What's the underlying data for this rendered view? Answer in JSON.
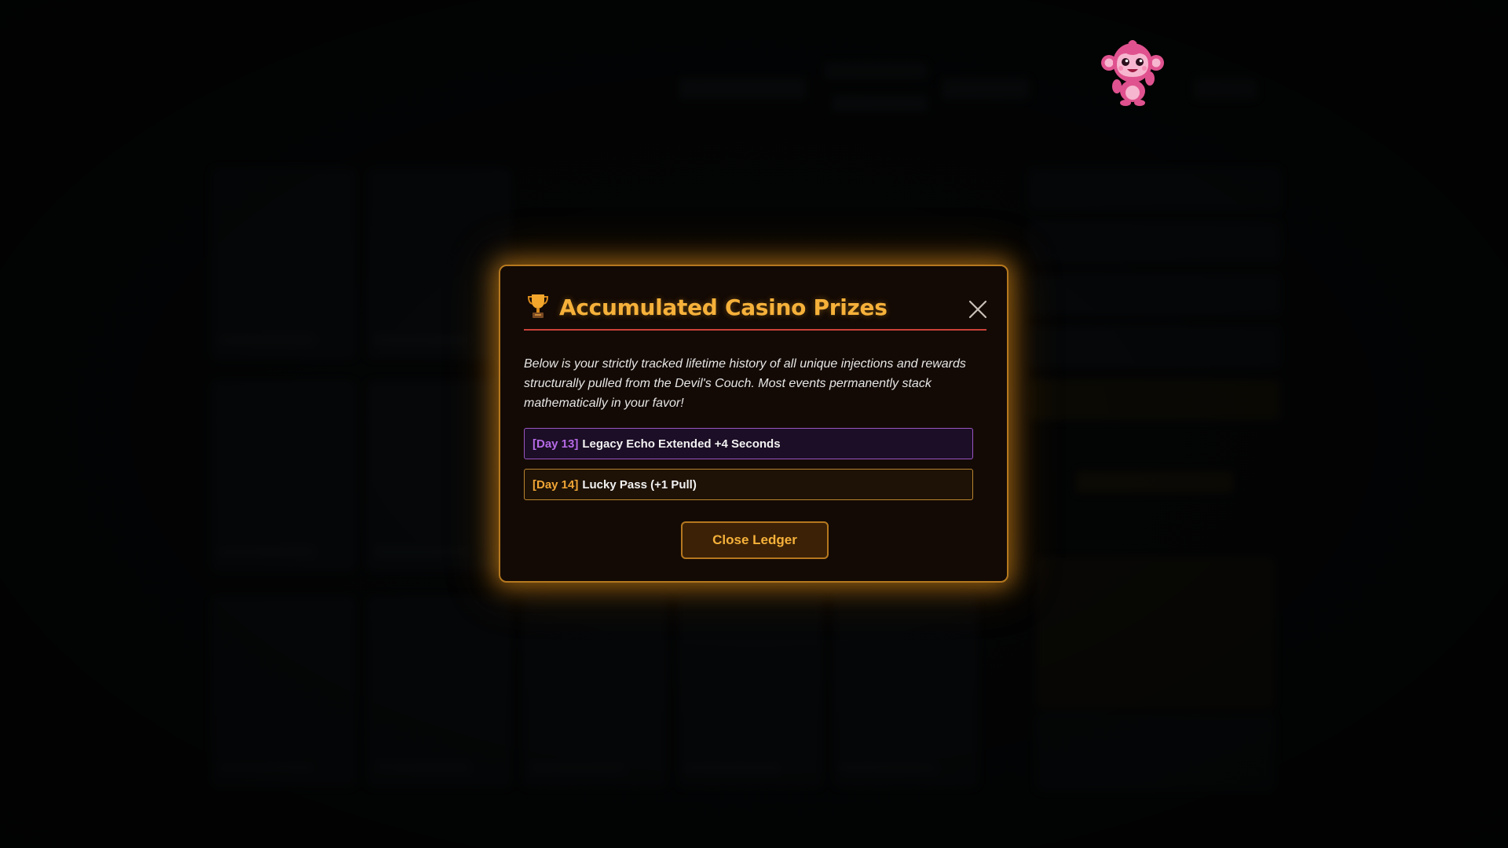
{
  "modal": {
    "title": "Accumulated Casino Prizes",
    "trophy_icon": "trophy-icon",
    "close_icon": "close-icon",
    "description": "Below is your strictly tracked lifetime history of all unique injections and rewards structurally pulled from the Devil's Couch. Most events permanently stack mathematically in your favor!",
    "ledger": [
      {
        "tag": "[Day 13]",
        "text": "Legacy Echo Extended +4 Seconds",
        "color": "#b66ae6"
      },
      {
        "tag": "[Day 14]",
        "text": "Lucky Pass (+1 Pull)",
        "color": "#f0a535"
      }
    ],
    "close_label": "Close Ledger"
  },
  "mascot": {
    "icon": "monkey-mascot-icon"
  },
  "colors": {
    "accent": "#f6b13a",
    "modal_border": "#b5781f",
    "divider": "#c9413a",
    "purple": "#9a55c2",
    "background": "#050607"
  }
}
